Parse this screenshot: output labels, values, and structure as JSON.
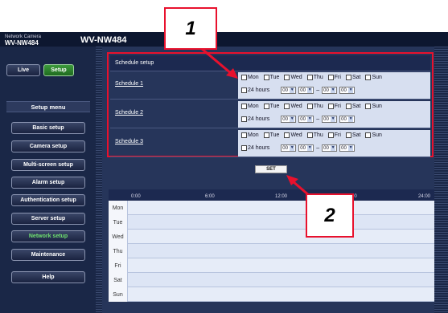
{
  "header": {
    "camera_label": "Network Camera",
    "camera_model": "WV-NW484",
    "model_title": "WV-NW484"
  },
  "nav": {
    "live_label": "Live",
    "setup_label": "Setup"
  },
  "sidebar": {
    "menu_title": "Setup menu",
    "items": [
      {
        "label": "Basic setup"
      },
      {
        "label": "Camera setup"
      },
      {
        "label": "Multi-screen setup"
      },
      {
        "label": "Alarm setup"
      },
      {
        "label": "Authentication setup"
      },
      {
        "label": "Server setup"
      },
      {
        "label": "Network setup"
      },
      {
        "label": "Maintenance"
      },
      {
        "label": "Help"
      }
    ],
    "active_item": "Network setup"
  },
  "schedule": {
    "title": "Schedule setup",
    "days": [
      "Mon",
      "Tue",
      "Wed",
      "Thu",
      "Fri",
      "Sat",
      "Sun"
    ],
    "all_day_label": "24 hours",
    "dash": "–",
    "rows": [
      {
        "label": "Schedule 1",
        "start_hour": "00",
        "start_min": "00",
        "end_hour": "00",
        "end_min": "00"
      },
      {
        "label": "Schedule 2",
        "start_hour": "00",
        "start_min": "00",
        "end_hour": "00",
        "end_min": "00"
      },
      {
        "label": "Schedule 3",
        "start_hour": "00",
        "start_min": "00",
        "end_hour": "00",
        "end_min": "00"
      }
    ]
  },
  "set_button": "SET",
  "timeline": {
    "hours": [
      "0:00",
      "6:00",
      "12:00",
      "00",
      "24:00"
    ],
    "days": [
      "Mon",
      "Tue",
      "Wed",
      "Thu",
      "Fri",
      "Sat",
      "Sun"
    ]
  },
  "callouts": [
    "1",
    "2"
  ],
  "colors": {
    "highlight": "#e8112d",
    "active_menu": "#6fe06f",
    "setup_button": "#3c9a3c"
  }
}
